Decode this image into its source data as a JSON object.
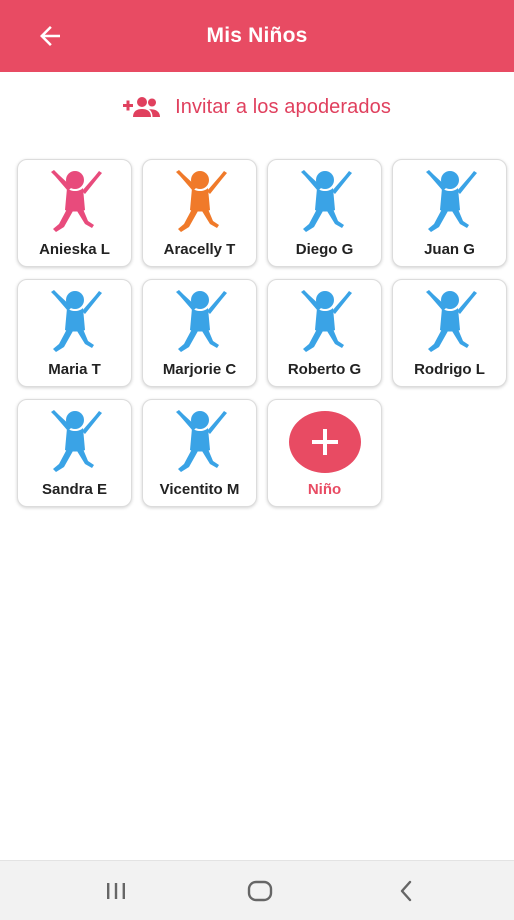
{
  "appbar": {
    "title": "Mis Niños",
    "background": "#e84b63",
    "back_icon": "arrow-left-icon"
  },
  "invite": {
    "label": "Invitar a los apoderados",
    "icon": "person-add-icon",
    "color": "#e0405e"
  },
  "children": [
    {
      "name": "Anieska L",
      "color": "#e84b7c"
    },
    {
      "name": "Aracelly T",
      "color": "#f07a2a"
    },
    {
      "name": "Diego G",
      "color": "#3aa3e6"
    },
    {
      "name": "Juan G",
      "color": "#3aa3e6"
    },
    {
      "name": "Maria T",
      "color": "#3aa3e6"
    },
    {
      "name": "Marjorie C",
      "color": "#3aa3e6"
    },
    {
      "name": "Roberto G",
      "color": "#3aa3e6"
    },
    {
      "name": "Rodrigo L",
      "color": "#3aa3e6"
    },
    {
      "name": "Sandra E",
      "color": "#3aa3e6"
    },
    {
      "name": "Vicentito M",
      "color": "#3aa3e6"
    }
  ],
  "add_child": {
    "label": "Niño",
    "icon": "plus-icon",
    "color": "#e84b63"
  },
  "system_nav": {
    "recents_icon": "recents-icon",
    "home_icon": "home-icon",
    "back_icon": "chevron-left-icon"
  }
}
